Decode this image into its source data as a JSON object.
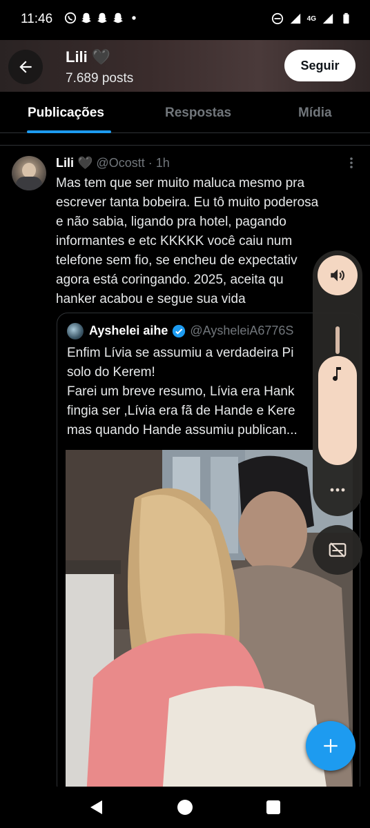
{
  "status_bar": {
    "time": "11:46",
    "network": "4G",
    "left_icons": [
      "whatsapp-icon",
      "snapchat-icon",
      "snapchat-icon",
      "snapchat-icon",
      "dot-icon"
    ],
    "right_icons": [
      "do-not-disturb-icon",
      "signal-icon",
      "signal-icon",
      "battery-icon"
    ]
  },
  "header": {
    "name": "Lili 🖤",
    "posts": "7.689 posts",
    "follow_label": "Seguir"
  },
  "tabs": [
    {
      "label": "Publicações",
      "active": true
    },
    {
      "label": "Respostas",
      "active": false
    },
    {
      "label": "Mídia",
      "active": false
    }
  ],
  "tweet": {
    "name": "Lili 🖤",
    "handle": "@Ocostt",
    "separator": "·",
    "time": "1h",
    "text": "Mas tem que ser muito maluca mesmo pra\nescrever tanta bobeira. Eu tô muito poderosa\ne não sabia, ligando pra hotel, pagando\ninformantes e etc KKKKK você caiu num\ntelefone sem fio, se encheu de expectativ\nagora está coringando. 2025, aceita qu\nhanker acabou e segue sua vida"
  },
  "quote": {
    "name": "Ayshelei aihe",
    "handle": "@AysheleiA6776S",
    "text": "Enfim Lívia se assumiu a verdadeira Pi\nsolo do Kerem!\nFarei um breve resumo, Lívia era Hank\nfingia ser ,Lívia era fã de Hande e Kere\nmas quando Hande assumiu publican..."
  },
  "colors": {
    "accent": "#1d9bf0",
    "background": "#000000",
    "muted_text": "#71767b",
    "volume_panel": "#f4d7c2"
  }
}
